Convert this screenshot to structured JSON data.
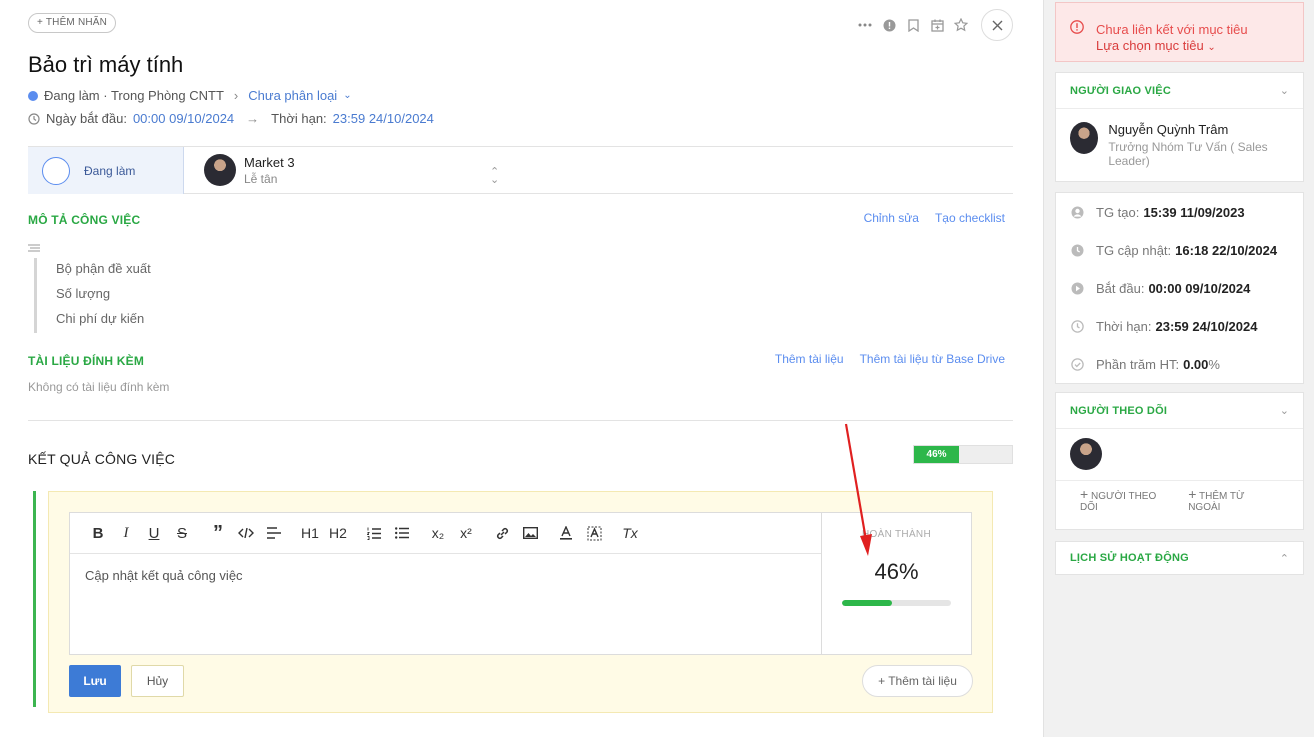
{
  "header": {
    "tag_button": "+ THÊM NHÃN",
    "title": "Bảo trì máy tính",
    "status_text": "Đang làm · Trong Phòng CNTT",
    "category": "Chưa phân loại",
    "start_label": "Ngày bắt đầu:",
    "start_value": "00:00 09/10/2024",
    "deadline_label": "Thời hạn:",
    "deadline_value": "23:59 24/10/2024",
    "icons": [
      "more-icon",
      "info-icon",
      "bookmark-icon",
      "calendar-icon",
      "star-icon",
      "close-icon"
    ]
  },
  "status_bar": {
    "status": "Đang làm",
    "assignee_name": "Market 3",
    "assignee_role": "Lễ tân"
  },
  "description": {
    "heading": "MÔ TẢ CÔNG VIỆC",
    "actions": [
      "Chỉnh sửa",
      "Tạo checklist"
    ],
    "items": [
      "Bộ phận đề xuất",
      "Số lượng",
      "Chi phí dự kiến"
    ]
  },
  "attachments": {
    "heading": "TÀI LIỆU ĐÍNH KÈM",
    "actions": [
      "Thêm tài liệu",
      "Thêm tài liệu từ Base Drive"
    ],
    "empty": "Không có tài liệu đính kèm"
  },
  "results": {
    "heading": "KẾT QUẢ CÔNG VIỆC",
    "progress": 46,
    "progress_label": "46%",
    "editor_placeholder": "Cập nhật kết quả công việc",
    "done_label": "HOÀN THÀNH",
    "done_value": "46%",
    "save": "Lưu",
    "cancel": "Hủy",
    "add_doc": "+ Thêm tài liệu",
    "toolbar": {
      "bold": "B",
      "italic": "I",
      "underline": "U",
      "strike": "S",
      "h1": "H1",
      "h2": "H2",
      "sub": "x₂",
      "sup": "x²",
      "clear": "Tx"
    }
  },
  "sidebar": {
    "alert_title": "Chưa liên kết với mục tiêu",
    "alert_link": "Lựa chọn mục tiêu",
    "giver_heading": "NGƯỜI GIAO VIỆC",
    "giver_name": "Nguyễn Quỳnh Trâm",
    "giver_role": "Trưởng Nhóm Tư Vấn ( Sales Leader)",
    "info": [
      {
        "label": "TG tạo:",
        "value": "15:39 11/09/2023"
      },
      {
        "label": "TG cập nhật:",
        "value": "16:18 22/10/2024"
      },
      {
        "label": "Bắt đầu:",
        "value": "00:00 09/10/2024"
      },
      {
        "label": "Thời hạn:",
        "value": "23:59 24/10/2024"
      },
      {
        "label": "Phần trăm HT:",
        "value": "0.00",
        "suffix": "%"
      }
    ],
    "followers_heading": "NGƯỜI THEO DÕI",
    "add_follower": "NGƯỜI THEO DÕI",
    "add_external": "THÊM TỪ NGOÀI",
    "history_heading": "LỊCH SỬ HOẠT ĐỘNG"
  },
  "colors": {
    "accent_green": "#2aa844",
    "link_blue": "#4a7bd0",
    "save_blue": "#3d7bd6",
    "progress_green": "#2db74a",
    "alert_red": "#e74c4c",
    "annotation_red": "#e02020"
  }
}
